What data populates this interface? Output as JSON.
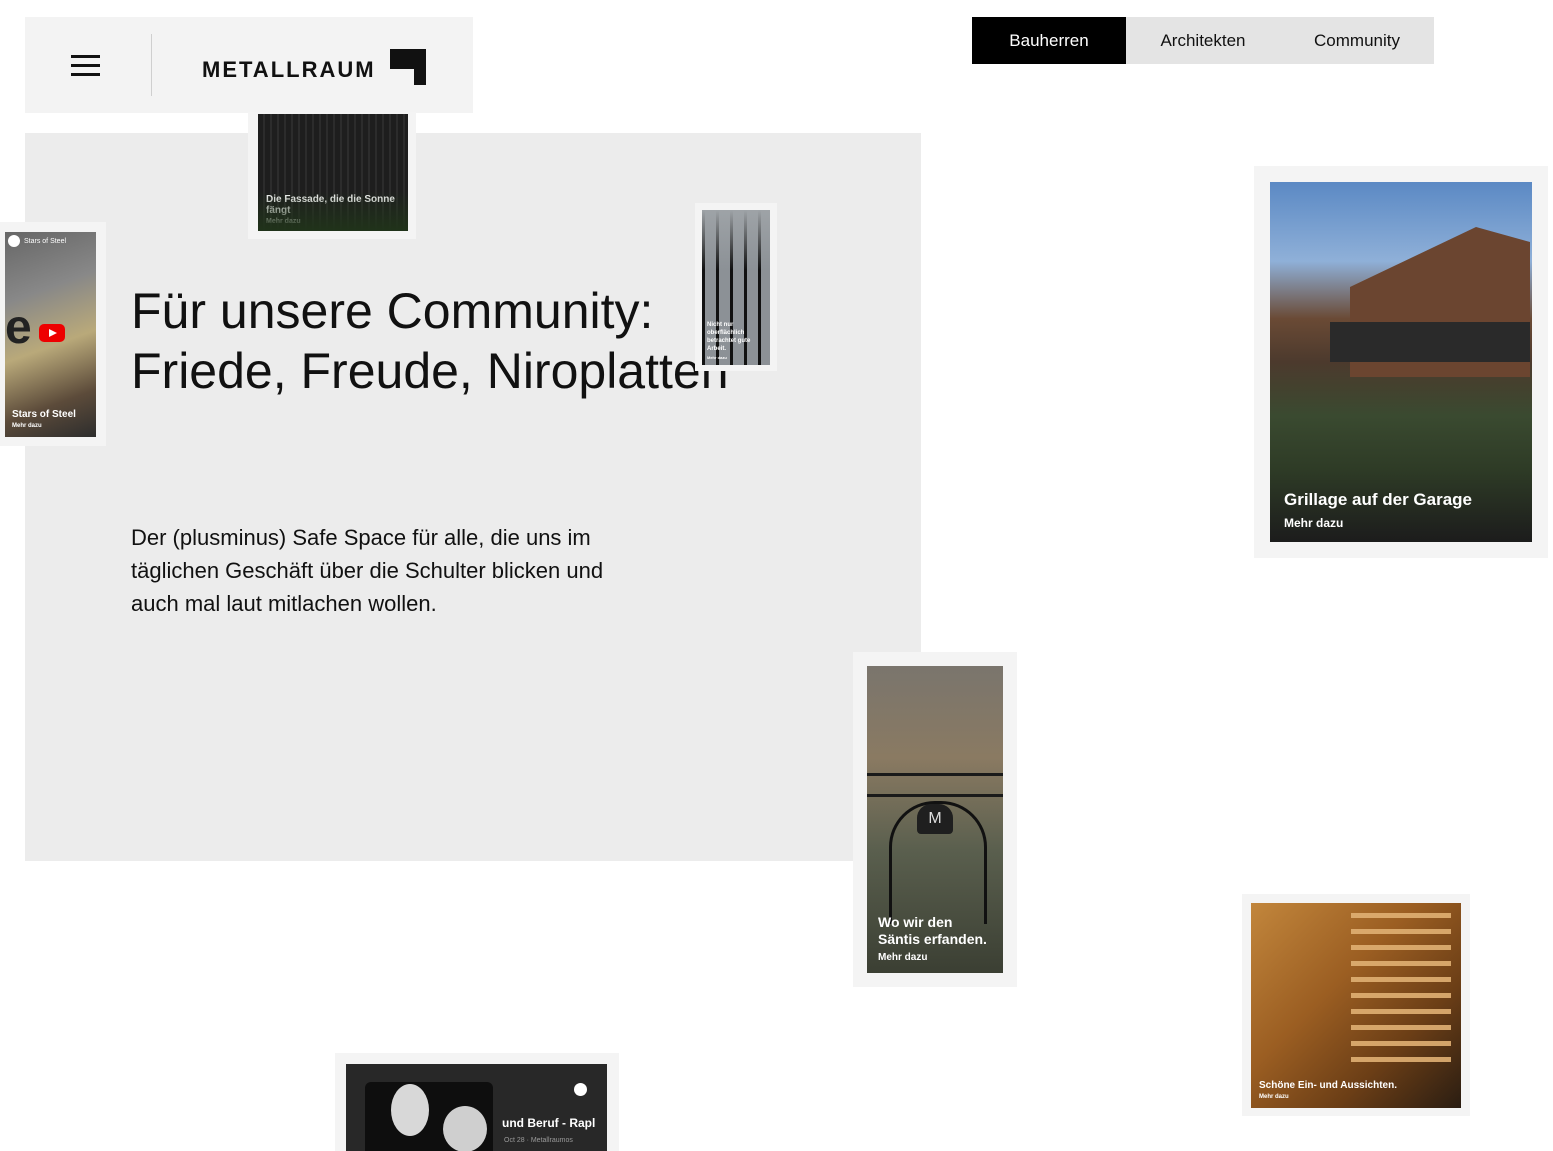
{
  "header": {
    "logo_text": "METALLRAUM"
  },
  "nav": {
    "tabs": [
      {
        "label": "Bauherren",
        "active": true
      },
      {
        "label": "Architekten",
        "active": false
      },
      {
        "label": "Community",
        "active": false
      }
    ]
  },
  "hero": {
    "title": "Für unsere Community: Friede, Freude, Niroplatten",
    "text": "Der (plusminus) Safe Space für alle, die uns im täglichen Geschäft über die Schulter blicken und auch mal laut mitlachen wollen."
  },
  "cards": {
    "facade": {
      "title": "Die Fassade, die die Sonne fängt",
      "link": "Mehr dazu"
    },
    "stars": {
      "channel": "Stars of Steel",
      "title": "Stars of Steel",
      "link": "Mehr dazu"
    },
    "railing": {
      "title": "Nicht nur oberflächlich betrachtet gute Arbeit.",
      "link": "Mehr dazu"
    },
    "grillage": {
      "title": "Grillage auf der Garage",
      "link": "Mehr dazu"
    },
    "saentis": {
      "title": "Wo wir den Säntis erfanden.",
      "link": "Mehr dazu"
    },
    "stairs": {
      "title": "Schöne Ein- und Aussichten.",
      "link": "Mehr dazu"
    },
    "podcast": {
      "title": "und Beruf - Rapl",
      "meta": "Oct 28 · Metallraumos"
    }
  },
  "colors": {
    "active_tab_bg": "#000000",
    "inactive_tab_bg": "#e4e4e4",
    "hero_bg": "#ececec"
  }
}
